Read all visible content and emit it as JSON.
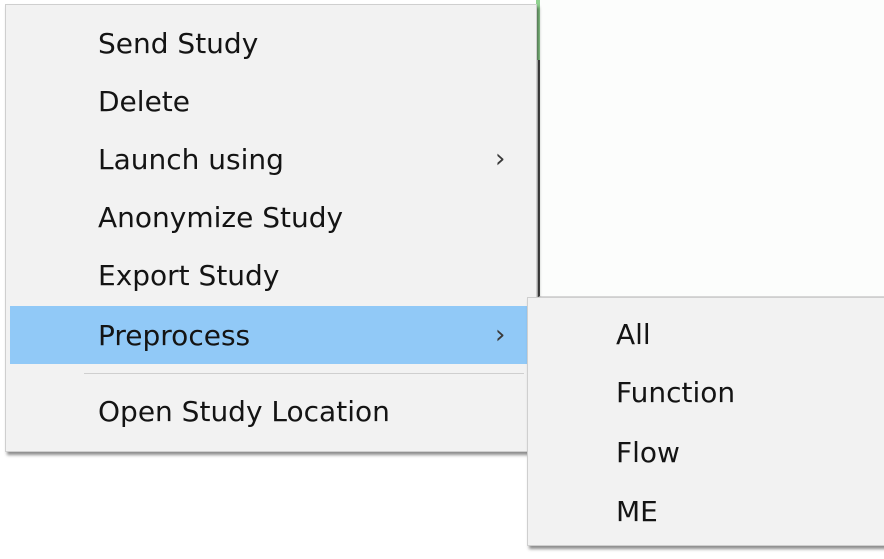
{
  "context_menu": {
    "items": [
      {
        "label": "Send Study",
        "has_submenu": false
      },
      {
        "label": "Delete",
        "has_submenu": false
      },
      {
        "label": "Launch using",
        "has_submenu": true
      },
      {
        "label": "Anonymize Study",
        "has_submenu": false
      },
      {
        "label": "Export Study",
        "has_submenu": false
      },
      {
        "label": "Preprocess",
        "has_submenu": true,
        "highlighted": true
      },
      {
        "label": "Open Study Location",
        "has_submenu": false
      }
    ],
    "submenu_arrow": "›",
    "highlight_color": "#91c9f7"
  },
  "preprocess_submenu": {
    "items": [
      {
        "label": "All"
      },
      {
        "label": "Function"
      },
      {
        "label": "Flow"
      },
      {
        "label": "ME"
      }
    ]
  }
}
